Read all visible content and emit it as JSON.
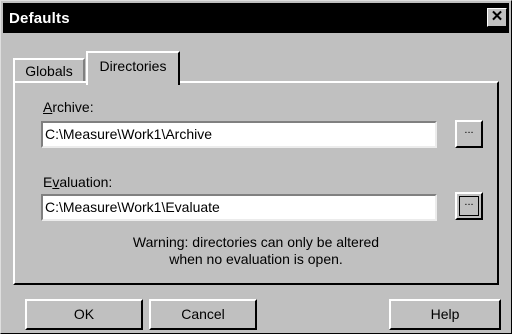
{
  "window": {
    "title": "Defaults",
    "close_glyph": "✕"
  },
  "tabs": [
    {
      "label": "Globals"
    },
    {
      "label": "Directories"
    }
  ],
  "archive": {
    "label_access": "A",
    "label_rest": "rchive:",
    "value": "C:\\Measure\\Work1\\Archive",
    "browse_label": "..."
  },
  "evaluation": {
    "label_pre": "E",
    "label_access": "v",
    "label_rest": "aluation:",
    "value": "C:\\Measure\\Work1\\Evaluate",
    "browse_label": "..."
  },
  "warning": {
    "line1": "Warning: directories can only be altered",
    "line2": "when no evaluation is open."
  },
  "buttons": {
    "ok": "OK",
    "cancel": "Cancel",
    "help": "Help"
  }
}
